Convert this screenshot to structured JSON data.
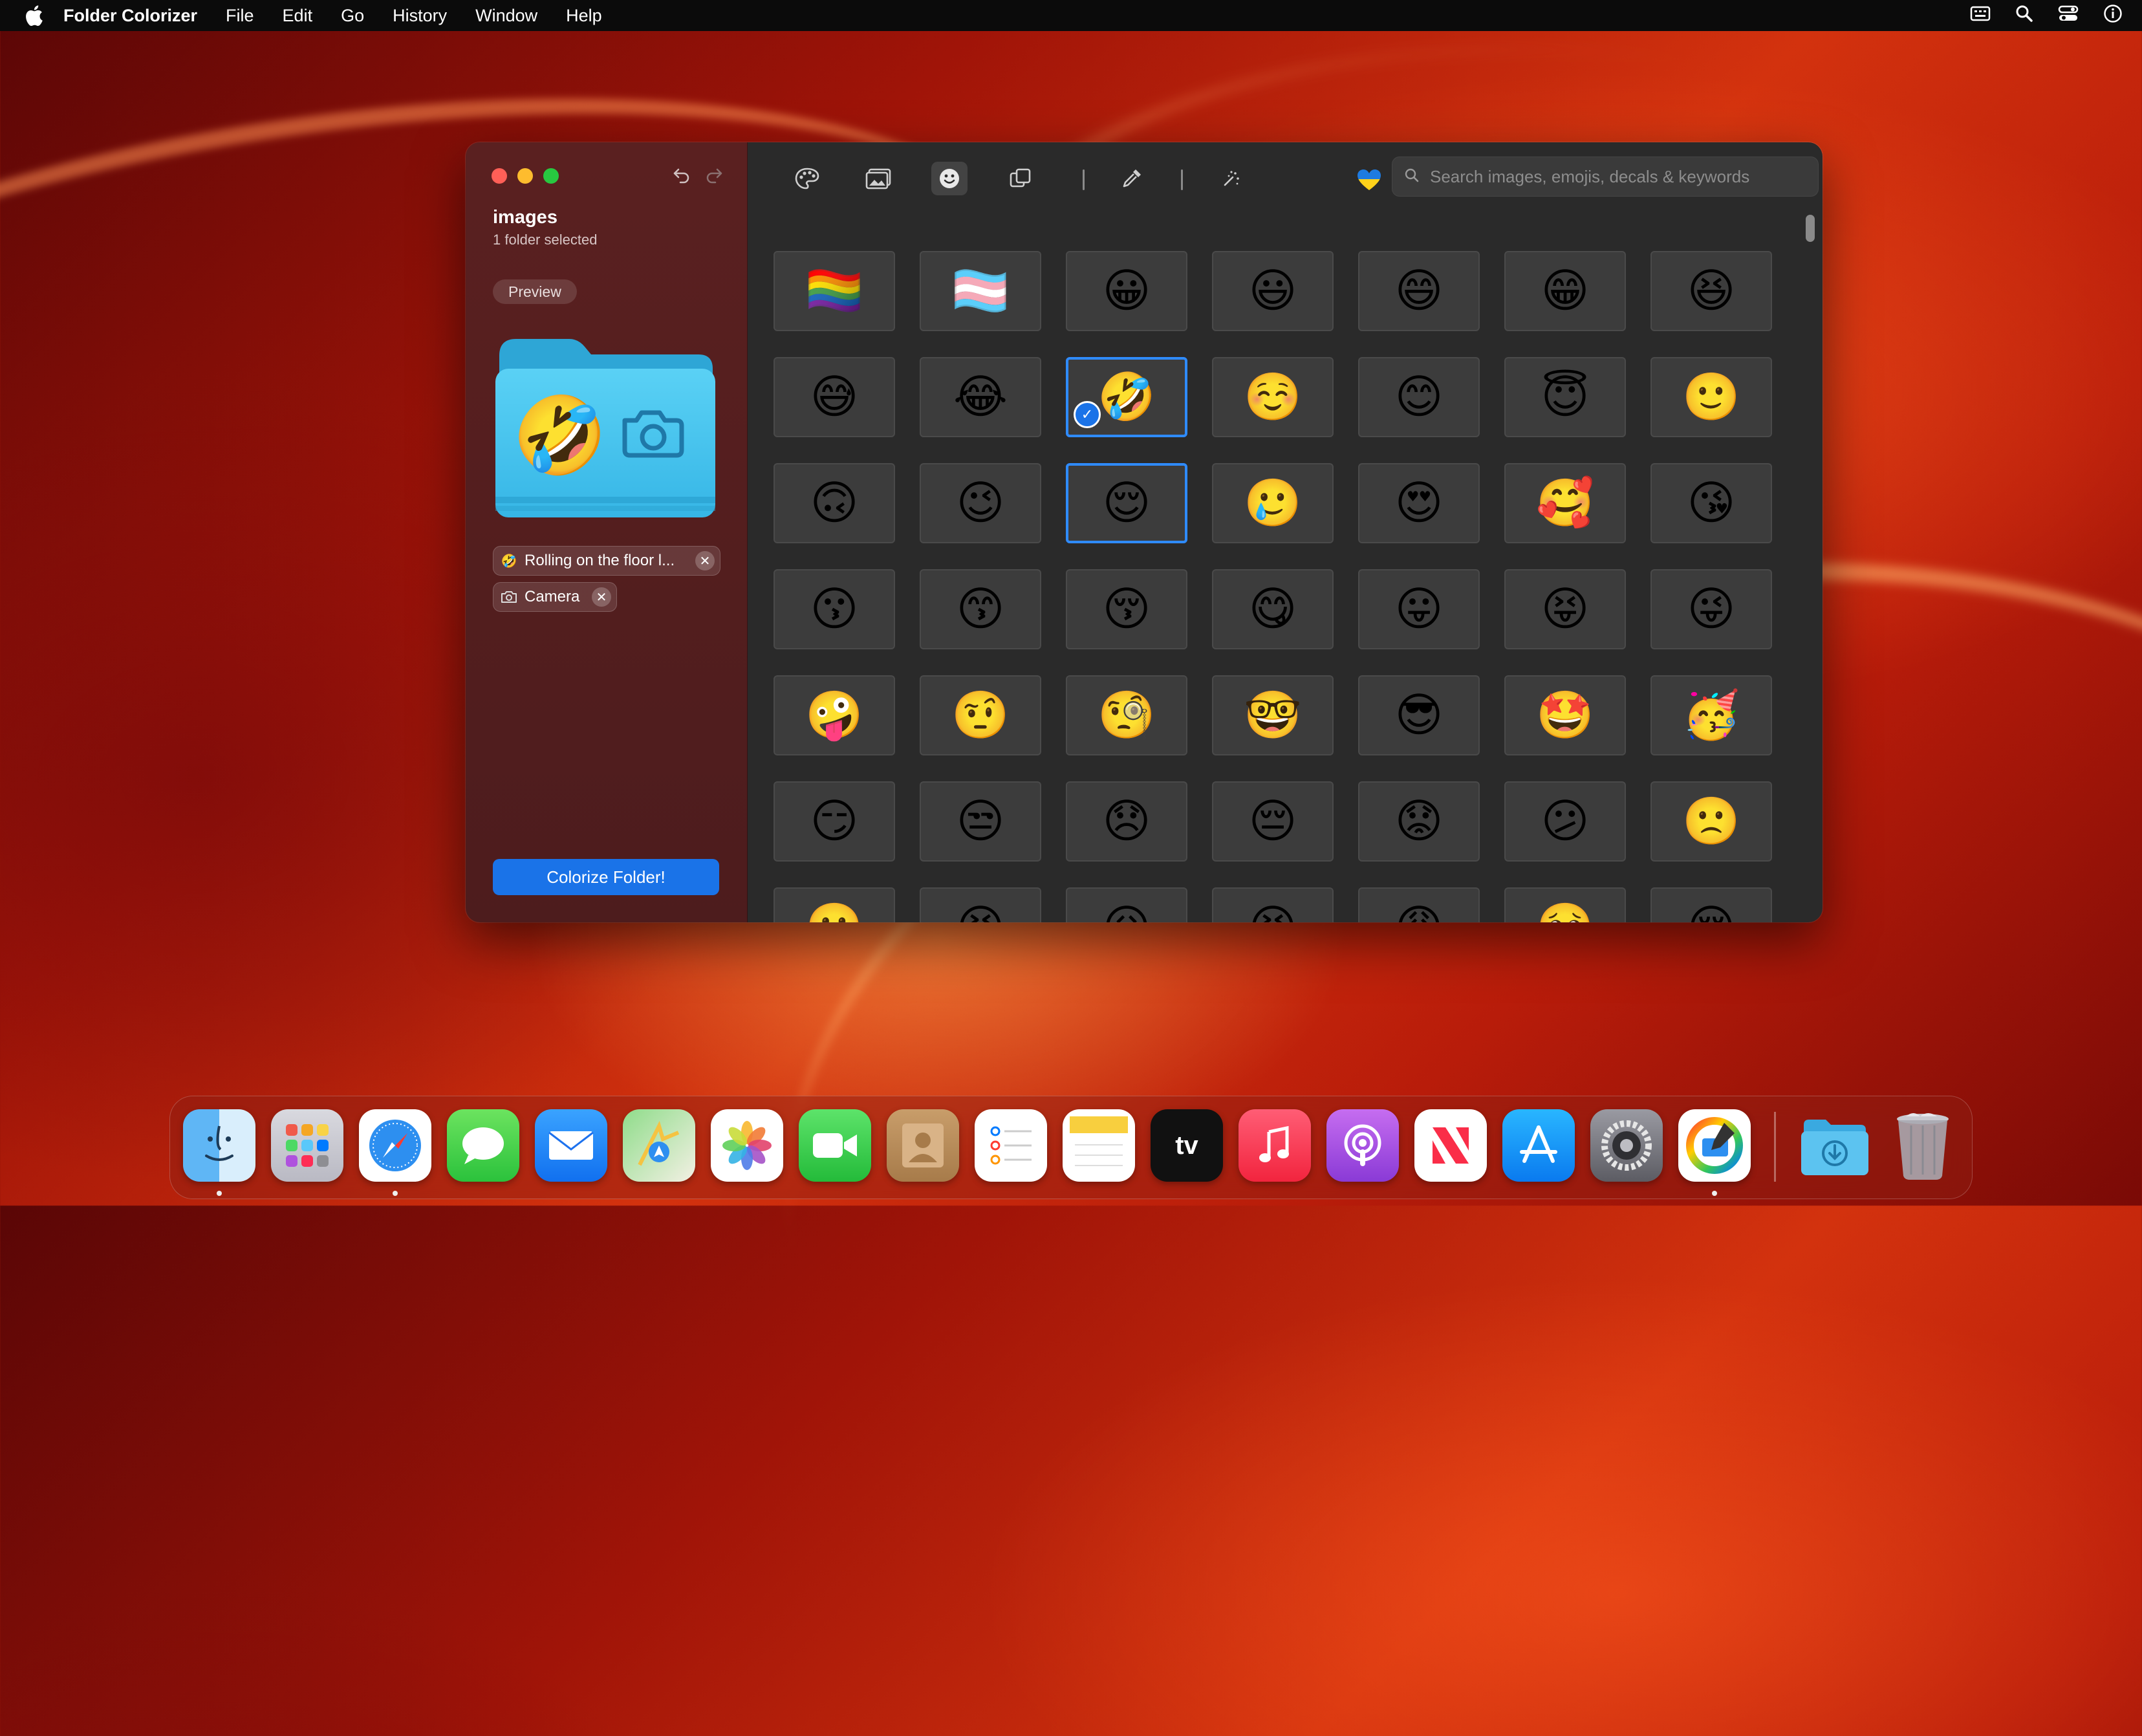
{
  "menubar": {
    "app_name": "Folder Colorizer",
    "items": [
      "File",
      "Edit",
      "Go",
      "History",
      "Window",
      "Help"
    ]
  },
  "sidebar": {
    "title": "images",
    "subtitle": "1 folder selected",
    "preview_label": "Preview",
    "preview_emoji": "🤣",
    "chips": [
      {
        "icon": "🤣",
        "label": "Rolling on the floor l..."
      },
      {
        "icon": "camera-icon",
        "label": "Camera"
      }
    ],
    "colorize_button": "Colorize Folder!"
  },
  "search": {
    "placeholder": "Search images, emojis, decals & keywords"
  },
  "toolbar": {
    "icons": [
      "palette-icon",
      "photo-icon",
      "emoji-icon",
      "shapes-icon",
      "eyedropper-icon",
      "magic-icon"
    ],
    "active": "emoji-icon",
    "heart": "💙"
  },
  "emoji_grid": {
    "rows": [
      [
        "🏳️‍🌈",
        "🏳️‍⚧️",
        "😀",
        "😃",
        "😄",
        "😁",
        "😆"
      ],
      [
        "😅",
        "😂",
        "🤣",
        "☺️",
        "😊",
        "😇",
        "🙂"
      ],
      [
        "🙃",
        "😉",
        "😌",
        "🥲",
        "😍",
        "🥰",
        "😘"
      ],
      [
        "😗",
        "😙",
        "😚",
        "😋",
        "😛",
        "😝",
        "😜"
      ],
      [
        "🤪",
        "🤨",
        "🧐",
        "🤓",
        "😎",
        "🤩",
        "🥳"
      ],
      [
        "😏",
        "😒",
        "😞",
        "😔",
        "😟",
        "😕",
        "🙁"
      ],
      [
        "☹️",
        "😣",
        "😖",
        "😫",
        "😩",
        "🥺",
        "😢"
      ]
    ],
    "selected": "🤣",
    "highlighted": "😌"
  },
  "dock": {
    "apps": [
      "Finder",
      "Launchpad",
      "Safari",
      "Messages",
      "Mail",
      "Maps",
      "Photos",
      "FaceTime",
      "Contacts",
      "Reminders",
      "Notes",
      "TV",
      "Music",
      "Podcasts",
      "News",
      "App Store",
      "System Settings",
      "Folder Colorizer"
    ],
    "tv_label": "tv"
  }
}
